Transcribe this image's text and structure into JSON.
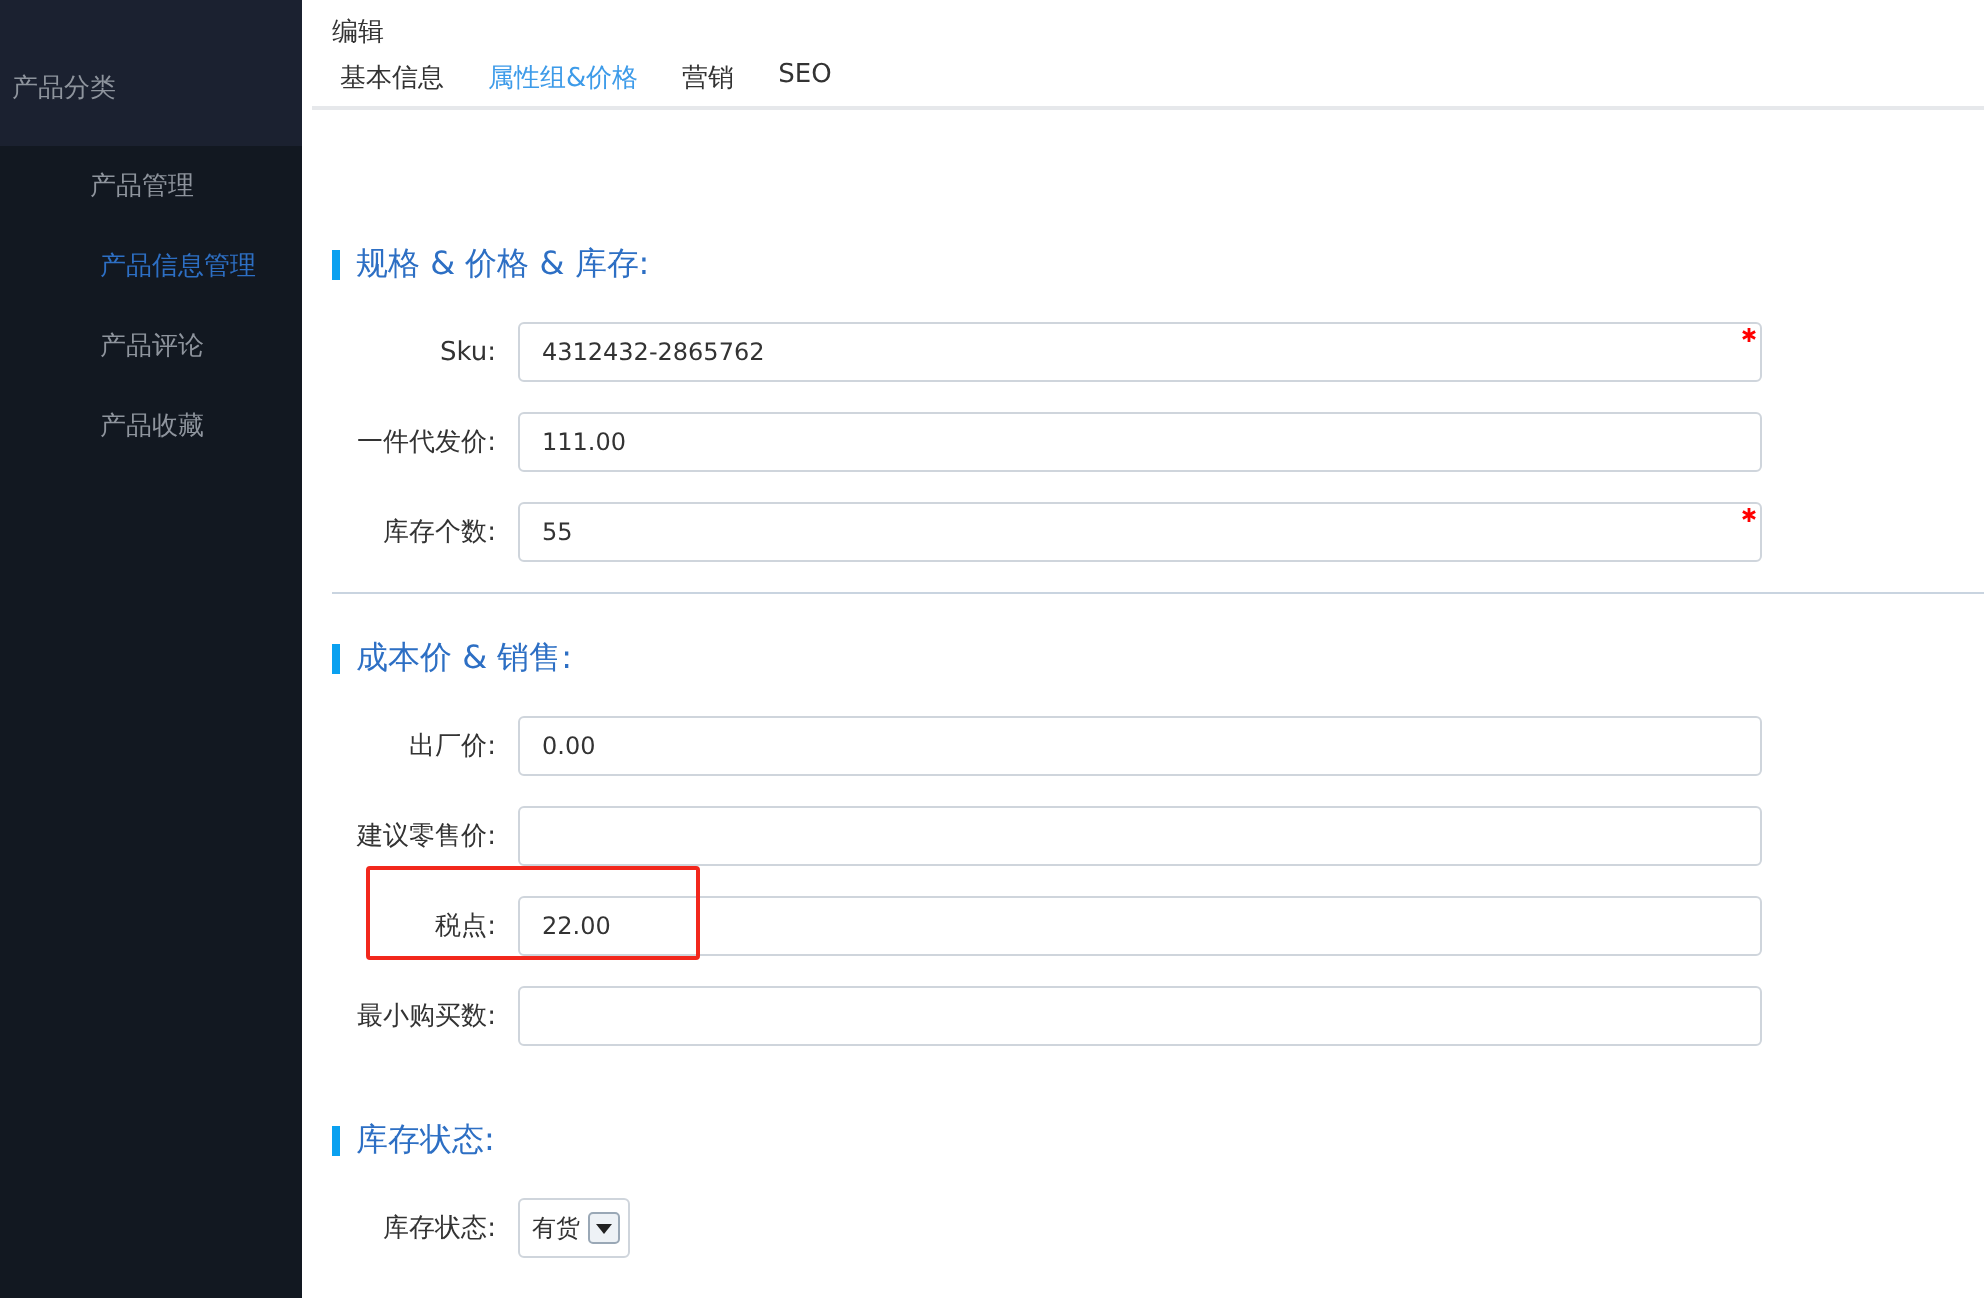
{
  "sidebar": {
    "header": "产品分类",
    "items": [
      {
        "label": "产品管理",
        "selected": false,
        "children": [
          {
            "label": "产品信息管理",
            "selected": true
          },
          {
            "label": "产品评论",
            "selected": false
          },
          {
            "label": "产品收藏",
            "selected": false
          }
        ]
      }
    ]
  },
  "page_title": "编辑",
  "tabs": [
    {
      "label": "基本信息",
      "selected": false
    },
    {
      "label": "属性组&价格",
      "selected": true
    },
    {
      "label": "营销",
      "selected": false
    },
    {
      "label": "SEO",
      "selected": false
    }
  ],
  "sections": [
    {
      "title": "规格 & 价格 & 库存:",
      "divider": true,
      "fields": [
        {
          "kind": "input",
          "label": "Sku:",
          "value": "4312432-2865762",
          "required": true,
          "highlighted": false
        },
        {
          "kind": "input",
          "label": "一件代发价:",
          "value": "111.00",
          "required": false,
          "highlighted": false
        },
        {
          "kind": "input",
          "label": "库存个数:",
          "value": "55",
          "required": true,
          "highlighted": false
        }
      ]
    },
    {
      "title": "成本价 & 销售:",
      "divider": false,
      "fields": [
        {
          "kind": "input",
          "label": "出厂价:",
          "value": "0.00",
          "required": false,
          "highlighted": false
        },
        {
          "kind": "input",
          "label": "建议零售价:",
          "required": false,
          "highlighted": false
        },
        {
          "kind": "input",
          "label": "税点:",
          "value": "22.00",
          "required": false,
          "highlighted": true
        },
        {
          "kind": "input",
          "label": "最小购买数:",
          "required": false,
          "highlighted": false
        }
      ]
    },
    {
      "title": "库存状态:",
      "divider": false,
      "fields": [
        {
          "kind": "select",
          "label": "库存状态:",
          "value": "有货",
          "required": false,
          "highlighted": false
        }
      ]
    }
  ]
}
